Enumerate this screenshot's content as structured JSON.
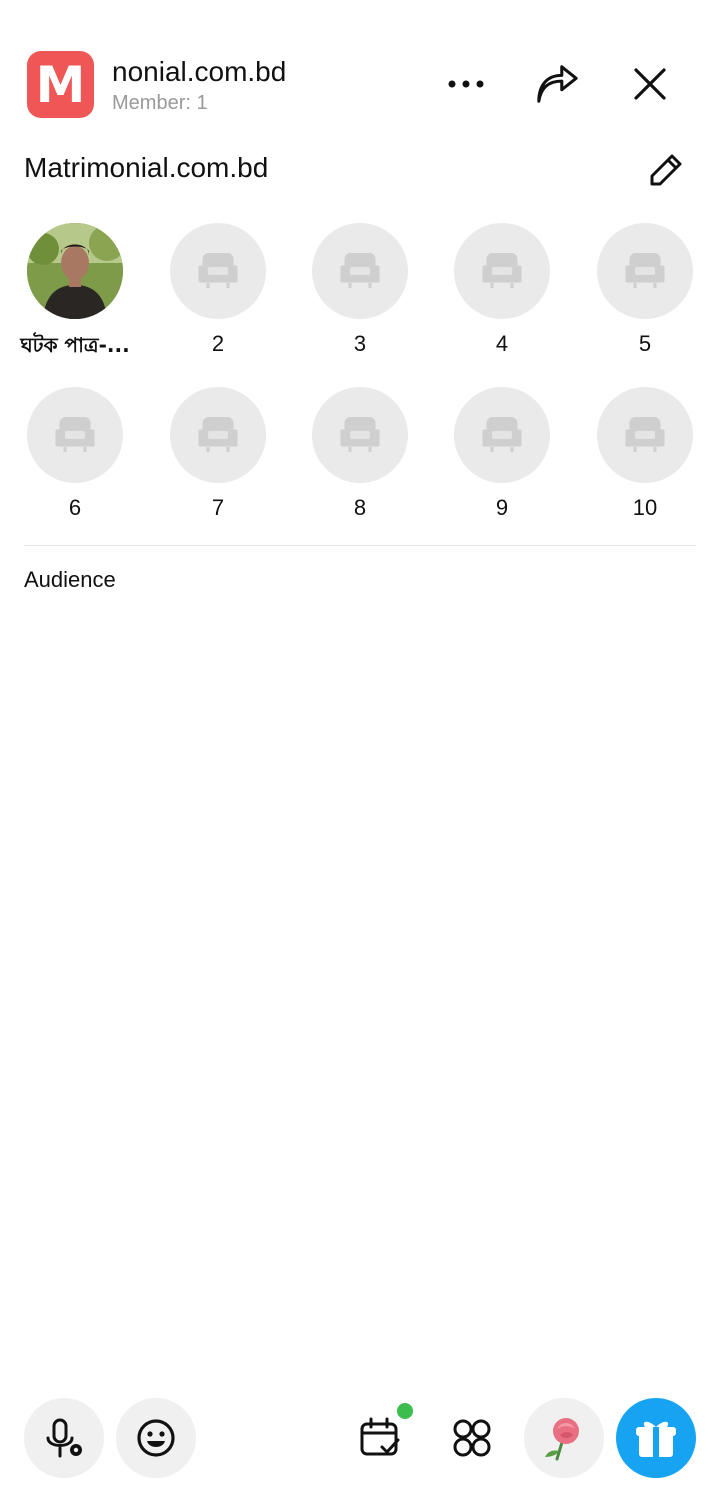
{
  "header": {
    "logo_letter": "M",
    "room_name": "nonial.com.bd",
    "member_count": "Member: 1"
  },
  "room": {
    "title": "Matrimonial.com.bd"
  },
  "seats": [
    {
      "label": "ঘটক পাত্র-..."
    },
    {
      "label": "2"
    },
    {
      "label": "3"
    },
    {
      "label": "4"
    },
    {
      "label": "5"
    },
    {
      "label": "6"
    },
    {
      "label": "7"
    },
    {
      "label": "8"
    },
    {
      "label": "9"
    },
    {
      "label": "10"
    }
  ],
  "audience": {
    "label": "Audience"
  },
  "colors": {
    "logo_bg": "#ef5656",
    "seat_empty": "#eaeaea",
    "gift_button": "#16a4f2",
    "notification_dot": "#3ebd4f"
  },
  "icons": [
    "more-icon",
    "share-icon",
    "close-icon",
    "edit-icon",
    "seat-icon",
    "mic-settings-icon",
    "emoji-icon",
    "calendar-check-icon",
    "apps-icon",
    "rose-icon",
    "gift-icon"
  ]
}
